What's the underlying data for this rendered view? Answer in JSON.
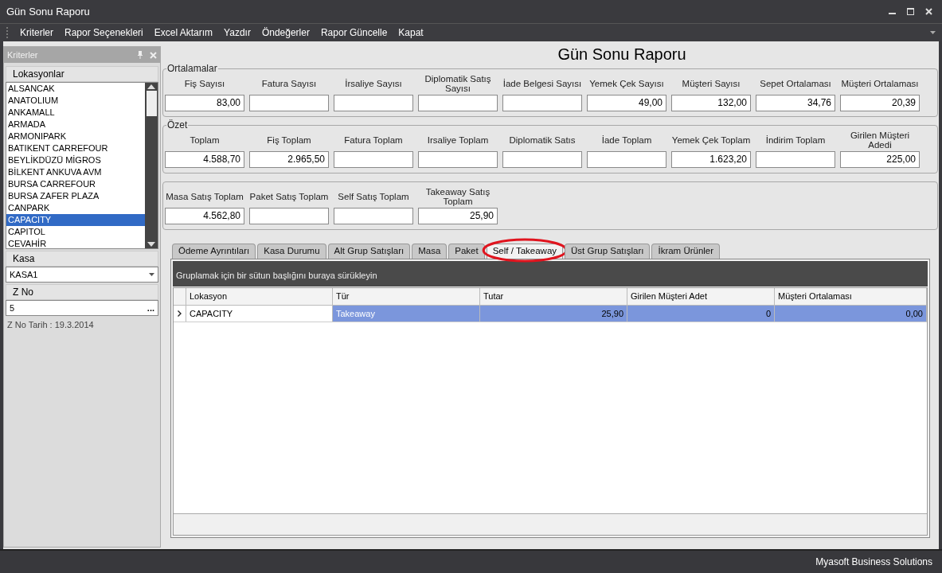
{
  "window": {
    "title": "Gün Sonu Raporu"
  },
  "menu": [
    "Kriterler",
    "Rapor Seçenekleri",
    "Excel Aktarım",
    "Yazdır",
    "Öndeğerler",
    "Rapor Güncelle",
    "Kapat"
  ],
  "sidebar": {
    "title": "Kriterler",
    "locations_label": "Lokasyonlar",
    "locations": [
      {
        "label": "ALSANCAK",
        "selected": false
      },
      {
        "label": "ANATOLIUM",
        "selected": false
      },
      {
        "label": "ANKAMALL",
        "selected": false
      },
      {
        "label": "ARMADA",
        "selected": false
      },
      {
        "label": "ARMONIPARK",
        "selected": false
      },
      {
        "label": "BATIKENT CARREFOUR",
        "selected": false
      },
      {
        "label": "BEYLİKDÜZÜ MİGROS",
        "selected": false
      },
      {
        "label": "BİLKENT ANKUVA AVM",
        "selected": false
      },
      {
        "label": "BURSA CARREFOUR",
        "selected": false
      },
      {
        "label": "BURSA ZAFER PLAZA",
        "selected": false
      },
      {
        "label": "CANPARK",
        "selected": false
      },
      {
        "label": "CAPACITY",
        "selected": true
      },
      {
        "label": "CAPITOL",
        "selected": false
      },
      {
        "label": "CEVAHİR",
        "selected": false
      }
    ],
    "kasa_label": "Kasa",
    "kasa_value": "KASA1",
    "zno_label": "Z No",
    "zno_value": "5",
    "zno_button": "...",
    "zno_date": "Z No Tarih : 19.3.2014"
  },
  "report_title": "Gün Sonu Raporu",
  "groups": [
    {
      "title": "Ortalamalar",
      "fields": [
        {
          "label": "Fiş Sayısı",
          "value": "83,00"
        },
        {
          "label": "Fatura Sayısı"
        },
        {
          "label": "İrsaliye Sayısı"
        },
        {
          "label": "Diplomatik Satış Sayısı"
        },
        {
          "label": "İade Belgesi Sayısı"
        },
        {
          "label": "Yemek Çek Sayısı",
          "value": "49,00"
        },
        {
          "label": "Müşteri Sayısı",
          "value": "132,00"
        },
        {
          "label": "Sepet Ortalaması",
          "value": "34,76"
        },
        {
          "label": "Müşteri Ortalaması",
          "value": "20,39"
        }
      ]
    },
    {
      "title": "Özet",
      "fields": [
        {
          "label": "Toplam",
          "value": "4.588,70"
        },
        {
          "label": "Fiş Toplam",
          "value": "2.965,50"
        },
        {
          "label": "Fatura Toplam"
        },
        {
          "label": "Irsaliye Toplam"
        },
        {
          "label": "Diplomatik Satıs"
        },
        {
          "label": "İade Toplam"
        },
        {
          "label": "Yemek Çek Toplam",
          "value": "1.623,20"
        },
        {
          "label": "İndirim Toplam"
        },
        {
          "label": "Girilen Müşteri Adedi",
          "value": "225,00"
        }
      ]
    },
    {
      "fields": [
        {
          "label": "Masa Satış Toplam",
          "value": "4.562,80"
        },
        {
          "label": "Paket Satış Toplam"
        },
        {
          "label": "Self Satış Toplam"
        },
        {
          "label": "Takeaway Satış Toplam",
          "value": "25,90"
        }
      ]
    }
  ],
  "tabs": [
    {
      "label": "Ödeme Ayrıntıları",
      "selected": false,
      "circled": false
    },
    {
      "label": "Kasa Durumu",
      "selected": false,
      "circled": false
    },
    {
      "label": "Alt Grup Satışları",
      "selected": false,
      "circled": false
    },
    {
      "label": "Masa",
      "selected": false,
      "circled": false
    },
    {
      "label": "Paket",
      "selected": false,
      "circled": false
    },
    {
      "label": "Self / Takeaway",
      "selected": true,
      "circled": true
    },
    {
      "label": "Üst Grup Satışları",
      "selected": false,
      "circled": false
    },
    {
      "label": "İkram Ürünler",
      "selected": false,
      "circled": false
    }
  ],
  "grid": {
    "group_hint": "Gruplamak için bir sütun başlığını buraya sürükleyin",
    "columns": [
      "Lokasyon",
      "Tür",
      "Tutar",
      "Girilen Müşteri Adet",
      "Müşteri Ortalaması"
    ],
    "rows": [
      {
        "selected": true,
        "cells": [
          "CAPACITY",
          "Takeaway",
          "25,90",
          "0",
          "0,00"
        ]
      }
    ]
  },
  "status_bar": "Myasoft Business Solutions"
}
